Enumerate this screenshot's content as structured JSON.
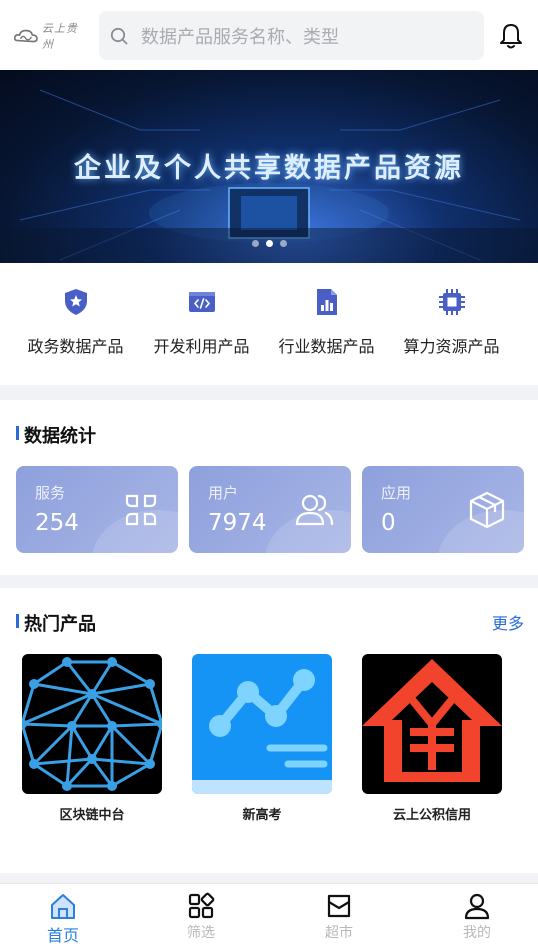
{
  "header": {
    "logo_text": "云上贵州",
    "search_placeholder": "数据产品服务名称、类型"
  },
  "banner": {
    "title": "企业及个人共享数据产品资源",
    "page_count": 3,
    "active_index": 1
  },
  "categories": [
    {
      "label": "政务数据产品",
      "icon": "shield-star-icon"
    },
    {
      "label": "开发利用产品",
      "icon": "code-icon"
    },
    {
      "label": "行业数据产品",
      "icon": "report-chart-icon"
    },
    {
      "label": "算力资源产品",
      "icon": "chip-icon"
    }
  ],
  "stats": {
    "title": "数据统计",
    "cards": [
      {
        "label": "服务",
        "value": "254",
        "icon": "service-icon"
      },
      {
        "label": "用户",
        "value": "7974",
        "icon": "users-icon"
      },
      {
        "label": "应用",
        "value": "0",
        "icon": "box-icon"
      }
    ]
  },
  "hot": {
    "title": "热门产品",
    "more_label": "更多",
    "products": [
      {
        "name": "区块链中台",
        "icon": "blockchain-network-icon"
      },
      {
        "name": "新高考",
        "icon": "trend-chart-icon"
      },
      {
        "name": "云上公积信用",
        "icon": "house-yuan-icon"
      }
    ]
  },
  "tabbar": {
    "items": [
      {
        "label": "首页",
        "icon": "home-icon",
        "active": true
      },
      {
        "label": "筛选",
        "icon": "grid-filter-icon",
        "active": false
      },
      {
        "label": "超市",
        "icon": "bag-icon",
        "active": false
      },
      {
        "label": "我的",
        "icon": "user-icon",
        "active": false
      }
    ]
  },
  "colors": {
    "accent": "#2a6bd8",
    "card": "#9aaae0",
    "icon_purple": "#4a5fc6"
  }
}
